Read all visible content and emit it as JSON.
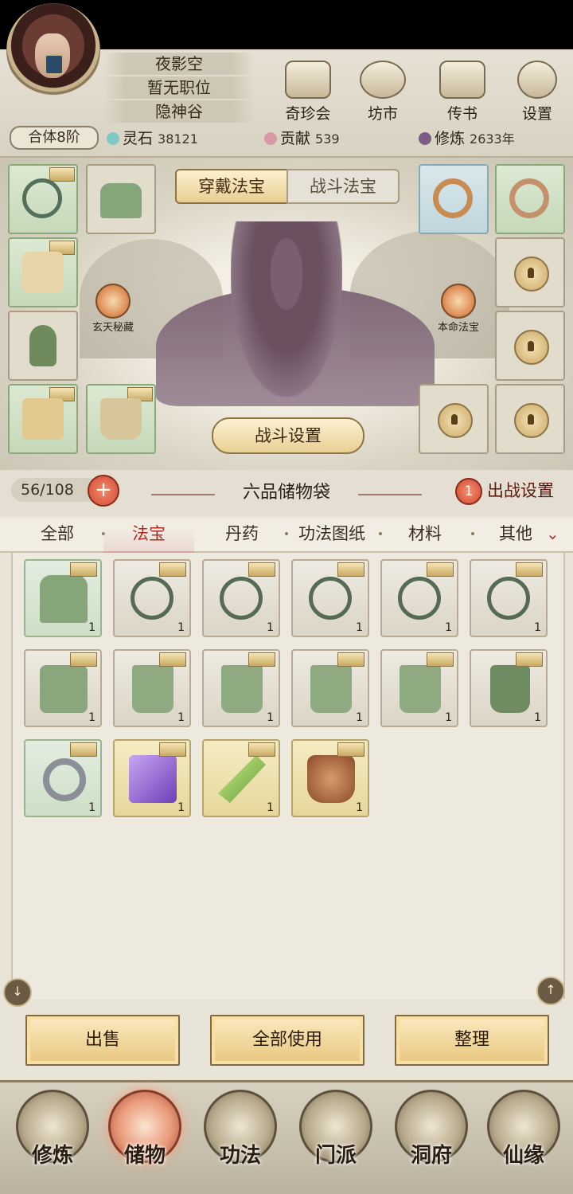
{
  "player": {
    "name": "夜影空",
    "position": "暂无职位",
    "sect": "隐神谷",
    "realm": "合体8阶"
  },
  "top_menu": [
    {
      "label": "奇珍会",
      "icon": "pavilion-icon"
    },
    {
      "label": "坊市",
      "icon": "market-icon"
    },
    {
      "label": "传书",
      "icon": "scroll-letter-icon"
    },
    {
      "label": "设置",
      "icon": "gear-icon"
    }
  ],
  "resources": {
    "spirit_stone": {
      "label": "灵石",
      "value": "38121"
    },
    "contribution": {
      "label": "贡献",
      "value": "539"
    },
    "cultivation": {
      "label": "修炼",
      "value": "2633年"
    }
  },
  "equip_tabs": {
    "worn": "穿戴法宝",
    "battle": "战斗法宝"
  },
  "side_buttons": {
    "left": "玄天秘藏",
    "right": "本命法宝"
  },
  "battle_settings": "战斗设置",
  "bag": {
    "capacity": "56/108",
    "title": "六品储物袋",
    "deploy_count": "1",
    "deploy_label": "出战设置"
  },
  "categories": [
    "全部",
    "法宝",
    "丹药",
    "功法图纸",
    "材料",
    "其他"
  ],
  "active_category": "法宝",
  "inventory": [
    {
      "icon": "hat-icon",
      "count": "1",
      "rarity": "green"
    },
    {
      "icon": "necklace-icon",
      "count": "1",
      "rarity": "grey"
    },
    {
      "icon": "necklace-icon",
      "count": "1",
      "rarity": "grey"
    },
    {
      "icon": "necklace-icon",
      "count": "1",
      "rarity": "grey"
    },
    {
      "icon": "necklace-icon",
      "count": "1",
      "rarity": "grey"
    },
    {
      "icon": "necklace-icon",
      "count": "1",
      "rarity": "grey"
    },
    {
      "icon": "robe-icon",
      "count": "1",
      "rarity": "grey"
    },
    {
      "icon": "pants-icon",
      "count": "1",
      "rarity": "grey"
    },
    {
      "icon": "pants-icon",
      "count": "1",
      "rarity": "grey"
    },
    {
      "icon": "pants-icon",
      "count": "1",
      "rarity": "grey"
    },
    {
      "icon": "pants-icon",
      "count": "1",
      "rarity": "grey"
    },
    {
      "icon": "boots-icon",
      "count": "1",
      "rarity": "grey"
    },
    {
      "icon": "ring-icon",
      "count": "1",
      "rarity": "green"
    },
    {
      "icon": "purple-crystal-icon",
      "count": "1",
      "rarity": "yellow"
    },
    {
      "icon": "jade-sword-icon",
      "count": "1",
      "rarity": "yellow"
    },
    {
      "icon": "cauldron-icon",
      "count": "1",
      "rarity": "yellow"
    }
  ],
  "actions": {
    "sell": "出售",
    "use_all": "全部使用",
    "sort": "整理"
  },
  "bottom_nav": [
    {
      "label": "修炼"
    },
    {
      "label": "储物"
    },
    {
      "label": "功法"
    },
    {
      "label": "门派"
    },
    {
      "label": "洞府"
    },
    {
      "label": "仙缘"
    }
  ],
  "colors": {
    "accent_red": "#b02d22",
    "gold": "#e8cf93",
    "slot_green": "#c5d9b9"
  }
}
